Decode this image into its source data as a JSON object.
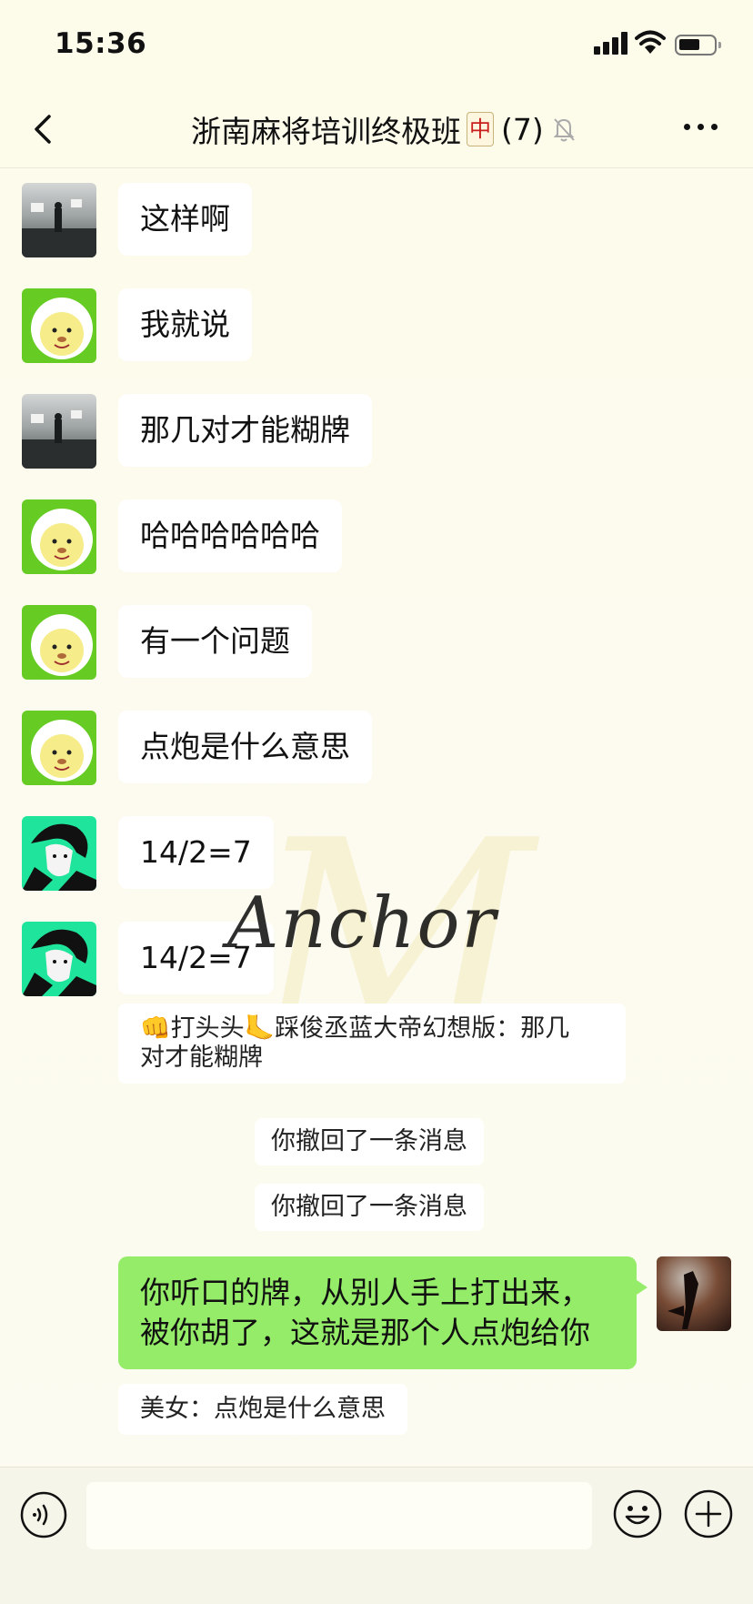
{
  "status": {
    "time": "15:36"
  },
  "header": {
    "title": "浙南麻将培训终极班",
    "tile_char": "中",
    "member_count": "(7)"
  },
  "messages": [
    {
      "sender": "dark",
      "text": "这样啊"
    },
    {
      "sender": "sheep",
      "text": "我就说"
    },
    {
      "sender": "dark",
      "text": "那几对才能糊牌"
    },
    {
      "sender": "sheep",
      "text": "哈哈哈哈哈哈"
    },
    {
      "sender": "sheep",
      "text": "有一个问题"
    },
    {
      "sender": "sheep",
      "text": "点炮是什么意思"
    },
    {
      "sender": "anime",
      "text": "14/2=7"
    },
    {
      "sender": "anime",
      "text": "14/2=7"
    }
  ],
  "quote_1": {
    "line1": "👊打头头🦶踩俊丞蓝大帝幻想版：那几",
    "line2": "对才能糊牌"
  },
  "system": {
    "recall_1": "你撤回了一条消息",
    "recall_2": "你撤回了一条消息"
  },
  "my_message": {
    "line1": "你听口的牌，从别人手上打出来，",
    "line2": "被你胡了，这就是那个人点炮给你"
  },
  "quote_2": {
    "text": "美女：点炮是什么意思"
  },
  "watermark": {
    "text": "Anchor",
    "mark": "M"
  },
  "input": {
    "value": ""
  },
  "colors": {
    "self_bubble": "#95ec69",
    "other_bubble": "#ffffff",
    "background": "#fdfbe9"
  }
}
